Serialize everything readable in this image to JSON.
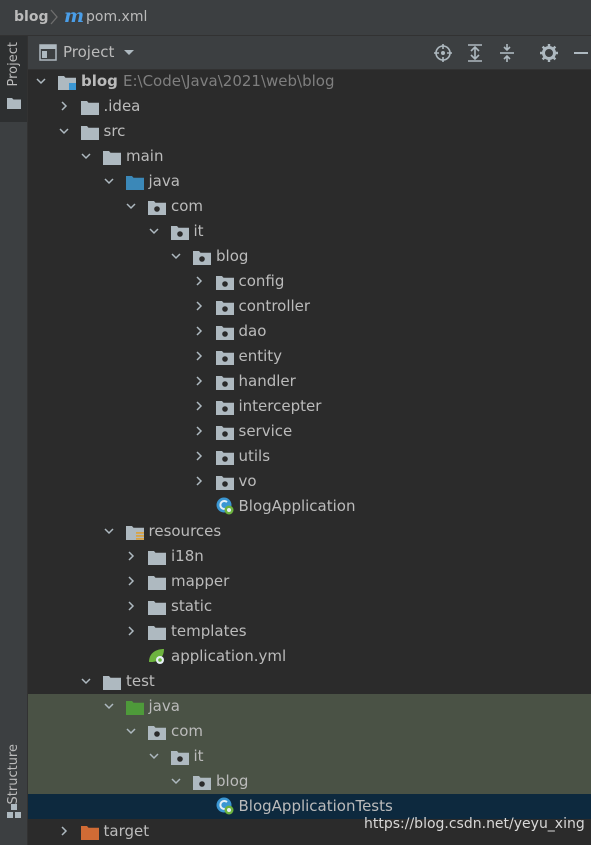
{
  "breadcrumb": {
    "project": "blog",
    "file": "pom.xml"
  },
  "sidebar": {
    "project_tab": "Project",
    "structure_tab": "Structure"
  },
  "panel": {
    "title": "Project"
  },
  "tree": [
    {
      "label": "blog",
      "path": "E:\\Code\\Java\\2021\\web\\blog",
      "depth": 0,
      "arrow": "down",
      "icon": "module",
      "bold": true
    },
    {
      "label": ".idea",
      "depth": 1,
      "arrow": "right",
      "icon": "folder"
    },
    {
      "label": "src",
      "depth": 1,
      "arrow": "down",
      "icon": "folder"
    },
    {
      "label": "main",
      "depth": 2,
      "arrow": "down",
      "icon": "folder"
    },
    {
      "label": "java",
      "depth": 3,
      "arrow": "down",
      "icon": "source-folder"
    },
    {
      "label": "com",
      "depth": 4,
      "arrow": "down",
      "icon": "package"
    },
    {
      "label": "it",
      "depth": 5,
      "arrow": "down",
      "icon": "package"
    },
    {
      "label": "blog",
      "depth": 6,
      "arrow": "down",
      "icon": "package"
    },
    {
      "label": "config",
      "depth": 7,
      "arrow": "right",
      "icon": "package"
    },
    {
      "label": "controller",
      "depth": 7,
      "arrow": "right",
      "icon": "package"
    },
    {
      "label": "dao",
      "depth": 7,
      "arrow": "right",
      "icon": "package"
    },
    {
      "label": "entity",
      "depth": 7,
      "arrow": "right",
      "icon": "package"
    },
    {
      "label": "handler",
      "depth": 7,
      "arrow": "right",
      "icon": "package"
    },
    {
      "label": "intercepter",
      "depth": 7,
      "arrow": "right",
      "icon": "package"
    },
    {
      "label": "service",
      "depth": 7,
      "arrow": "right",
      "icon": "package"
    },
    {
      "label": "utils",
      "depth": 7,
      "arrow": "right",
      "icon": "package"
    },
    {
      "label": "vo",
      "depth": 7,
      "arrow": "right",
      "icon": "package"
    },
    {
      "label": "BlogApplication",
      "depth": 7,
      "arrow": "none",
      "icon": "spring-class"
    },
    {
      "label": "resources",
      "depth": 3,
      "arrow": "down",
      "icon": "resources-folder"
    },
    {
      "label": "i18n",
      "depth": 4,
      "arrow": "right",
      "icon": "folder"
    },
    {
      "label": "mapper",
      "depth": 4,
      "arrow": "right",
      "icon": "folder"
    },
    {
      "label": "static",
      "depth": 4,
      "arrow": "right",
      "icon": "folder"
    },
    {
      "label": "templates",
      "depth": 4,
      "arrow": "right",
      "icon": "folder"
    },
    {
      "label": "application.yml",
      "depth": 4,
      "arrow": "none",
      "icon": "spring-yml"
    },
    {
      "label": "test",
      "depth": 2,
      "arrow": "down",
      "icon": "folder"
    },
    {
      "label": "java",
      "depth": 3,
      "arrow": "down",
      "icon": "test-folder",
      "test": true
    },
    {
      "label": "com",
      "depth": 4,
      "arrow": "down",
      "icon": "package",
      "test": true
    },
    {
      "label": "it",
      "depth": 5,
      "arrow": "down",
      "icon": "package",
      "test": true
    },
    {
      "label": "blog",
      "depth": 6,
      "arrow": "down",
      "icon": "package",
      "test": true
    },
    {
      "label": "BlogApplicationTests",
      "depth": 7,
      "arrow": "none",
      "icon": "spring-class",
      "selected": true
    },
    {
      "label": "target",
      "depth": 1,
      "arrow": "right",
      "icon": "excluded-folder"
    }
  ],
  "watermark": "https://blog.csdn.net/yeyu_xing",
  "colors": {
    "background": "#2b2b2b",
    "chrome": "#3c3f41",
    "text": "#bbbbbb",
    "selection": "#0d293e",
    "test_bg": "#4a5245",
    "source_folder": "#3b88b8",
    "test_folder": "#4e9a3a",
    "excluded_folder": "#d06b35",
    "maven_m": "#4a9ee8"
  }
}
